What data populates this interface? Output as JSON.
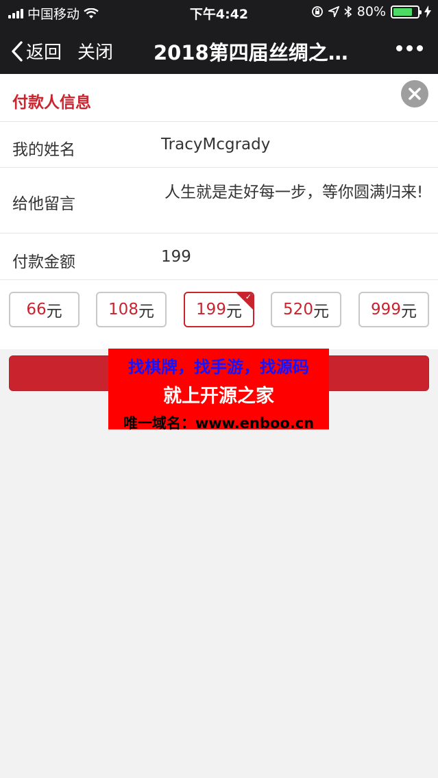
{
  "status_bar": {
    "carrier": "中国移动",
    "time": "下午4:42",
    "battery": "80%",
    "battery_level": 0.8
  },
  "nav": {
    "back_label": "返回",
    "close_label": "关闭",
    "title": "2018第四届丝绸之…"
  },
  "form": {
    "section_title": "付款人信息",
    "name_label": "我的姓名",
    "name_value": "TracyMcgrady",
    "message_label": "给他留言",
    "message_value": "人生就是走好每一步，等你圆满归来!",
    "amount_label": "付款金额",
    "amount_value": "199"
  },
  "amounts": [
    {
      "num": "66",
      "unit": "元",
      "selected": false
    },
    {
      "num": "108",
      "unit": "元",
      "selected": false
    },
    {
      "num": "199",
      "unit": "元",
      "selected": true
    },
    {
      "num": "520",
      "unit": "元",
      "selected": false
    },
    {
      "num": "999",
      "unit": "元",
      "selected": false
    }
  ],
  "overlay": {
    "line1": "找棋牌，找手游，找源码",
    "line2": "就上开源之家",
    "line3": "唯一域名：www.enboo.cn"
  },
  "colors": {
    "accent": "#c9232e",
    "nav_bg": "#1c1c1e",
    "battery": "#4cd964"
  }
}
